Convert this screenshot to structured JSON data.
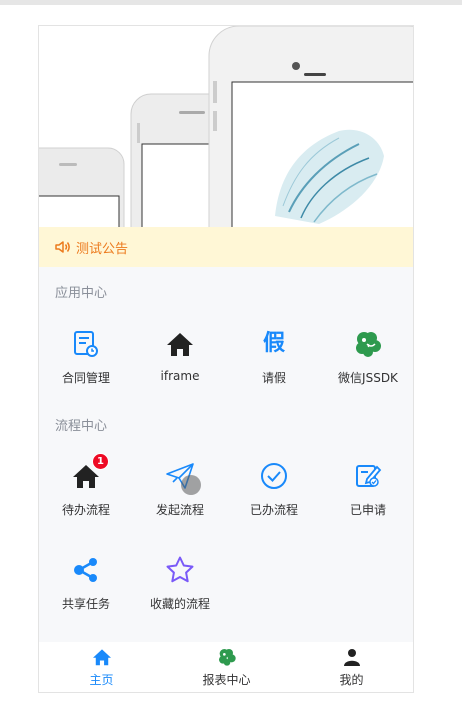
{
  "notice": {
    "text": "测试公告",
    "icon": "volume-icon",
    "color": "#ec7a1d",
    "background": "#fff7d6"
  },
  "app_center": {
    "title": "应用中心",
    "items": [
      {
        "label": "合同管理",
        "icon": "contract-icon"
      },
      {
        "label": "iframe",
        "icon": "home-icon"
      },
      {
        "label": "请假",
        "icon": "leave-icon",
        "glyph": "假"
      },
      {
        "label": "微信JSSDK",
        "icon": "wechat-icon"
      }
    ]
  },
  "process_center": {
    "title": "流程中心",
    "items": [
      {
        "label": "待办流程",
        "icon": "home-icon",
        "badge": "1"
      },
      {
        "label": "发起流程",
        "icon": "send-icon"
      },
      {
        "label": "已办流程",
        "icon": "check-circle-icon"
      },
      {
        "label": "已申请",
        "icon": "edit-icon"
      },
      {
        "label": "共享任务",
        "icon": "share-icon"
      },
      {
        "label": "收藏的流程",
        "icon": "star-icon"
      }
    ]
  },
  "tabbar": {
    "items": [
      {
        "label": "主页",
        "icon": "home-icon",
        "active": true
      },
      {
        "label": "报表中心",
        "icon": "report-icon",
        "active": false
      },
      {
        "label": "我的",
        "icon": "user-icon",
        "active": false
      }
    ]
  },
  "colors": {
    "accent": "#1989fa",
    "badge": "#ee0a24",
    "green": "#2e9a4e",
    "purple": "#7a5af8"
  }
}
